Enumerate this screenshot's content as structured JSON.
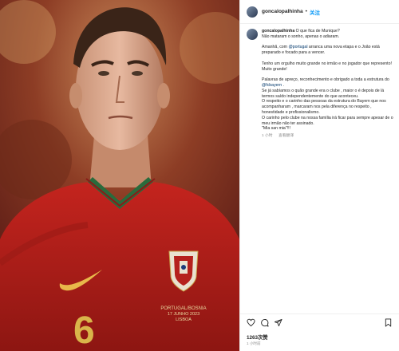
{
  "post": {
    "username": "goncalopalhinha",
    "follow_label": "关注",
    "separator": "•",
    "image": {
      "crest_text_1": "PORTUGAL/BOSNIA",
      "crest_text_2": "17 JUNHO 2023",
      "crest_text_3": "LISBOA",
      "number": "6"
    }
  },
  "caption": {
    "username": "goncalopalhinha",
    "l1": "O que fica de Munique?",
    "l2": "Não mataram o sonho, apenas o adiaram.",
    "l3a": "Amanhã, com ",
    "l3link": "@portugal",
    "l3b": " arranca uma nova etapa e o João está preparado e focado para a vencer.",
    "l4": "Tenho um orgulho muito grande no irmão e no jogador que represento!",
    "l5": "Muito grande!",
    "l6": "Palavras de apreço, reconhecimento e obrigado a toda a estrutura do ",
    "l6link": "@fcbayern",
    "l6b": " .",
    "l7": "Se já sabíamos o quão grande era o clube , maior o é depois de lá termos saído independentemente do que aconteceu.",
    "l8": "O respeito e o carinho das pessoas da estrutura do Bayern que nos acompanharam , marcaram nos pela diferença no respeito , honestidade e profissionalismo.",
    "l9": "O carinho pelo clube na nossa família irá ficar para sempre apesar de o meu irmão não ter assinado.",
    "l10": "\"Mia san mia\"!!!",
    "meta_time": "1 小时",
    "meta_translate": "查看翻译"
  },
  "actions": {
    "likes": "1263次赞",
    "time": "1 小时前",
    "icons": [
      "heart-icon",
      "comment-icon",
      "share-icon",
      "bookmark-icon"
    ]
  },
  "colors": {
    "accent": "#0095f6",
    "shirt": "#b5211d",
    "trim": "#2a6b3c",
    "number": "#d9b54a"
  }
}
